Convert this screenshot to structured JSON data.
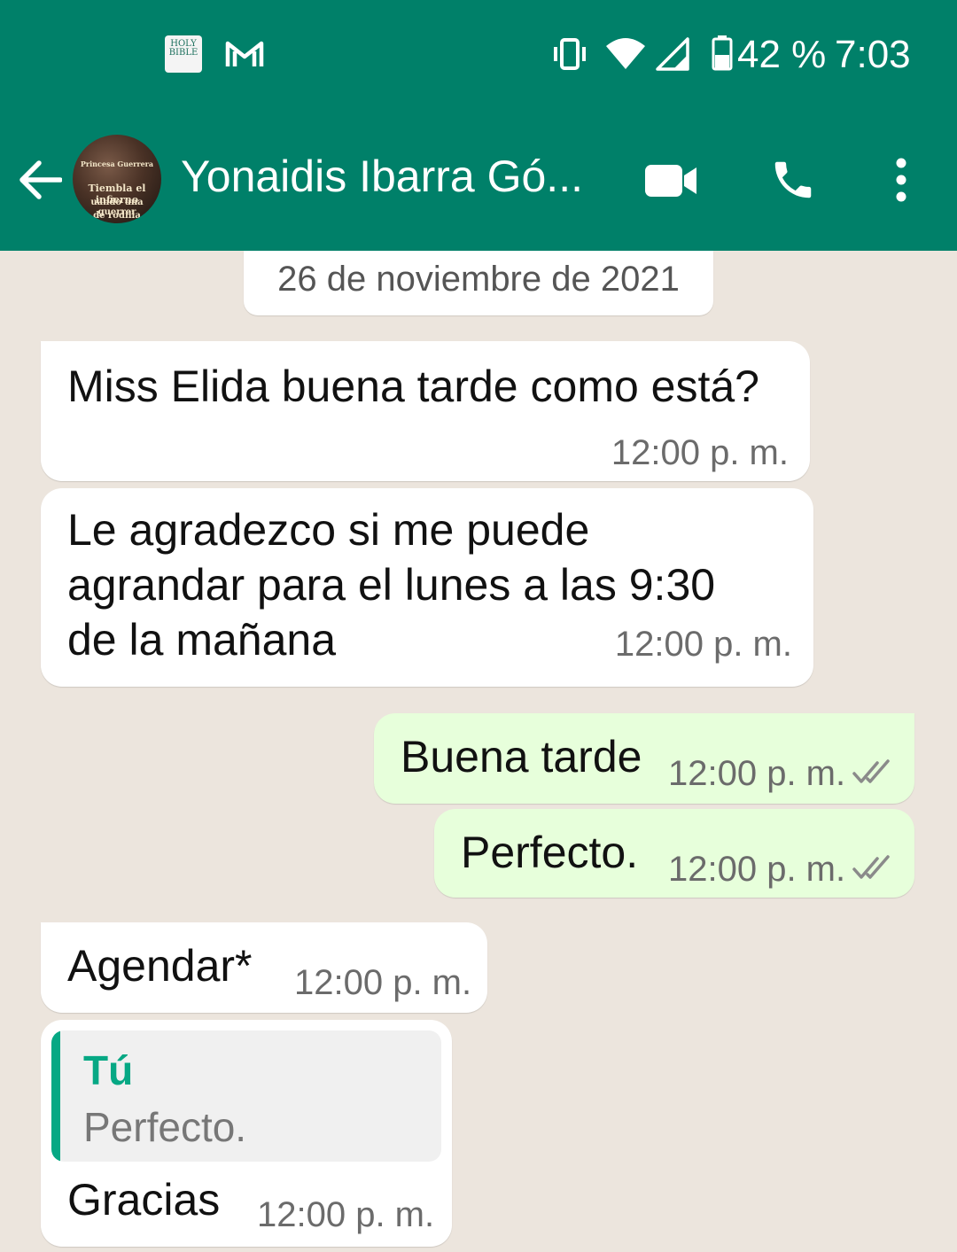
{
  "status_bar": {
    "bible_icon_text": "HOLY BIBLE",
    "battery": "42 %",
    "time": "7:03"
  },
  "header": {
    "contact_name": "Yonaidis Ibarra Gó...",
    "avatar_text": [
      "Princesa Guerrera",
      "Tiembla el infierno",
      "uando una guerrer",
      "de rodilla"
    ]
  },
  "chat": {
    "date_chip": "26 de noviembre de 2021",
    "messages": [
      {
        "direction": "in",
        "lines": [
          "Miss Elida buena tarde como está?"
        ],
        "time": "12:00 p. m."
      },
      {
        "direction": "in",
        "lines": [
          "Le agradezco si me puede",
          "agrandar para el lunes a las 9:30",
          "de la mañana"
        ],
        "time": "12:00 p. m."
      },
      {
        "direction": "out",
        "lines": [
          "Buena tarde"
        ],
        "time": "12:00 p. m.",
        "status": "read"
      },
      {
        "direction": "out",
        "lines": [
          "Perfecto."
        ],
        "time": "12:00 p. m.",
        "status": "read"
      },
      {
        "direction": "in",
        "lines": [
          "Agendar*"
        ],
        "time": "12:00 p. m."
      },
      {
        "direction": "in",
        "quote": {
          "author": "Tú",
          "text": "Perfecto."
        },
        "lines": [
          "Gracias"
        ],
        "time": "12:00 p. m."
      }
    ]
  },
  "colors": {
    "header": "#008069",
    "chat_background": "#ECE5DD",
    "outgoing_bubble": "#E7FFDB",
    "incoming_bubble": "#FFFFFF",
    "quote_accent": "#06A884"
  }
}
